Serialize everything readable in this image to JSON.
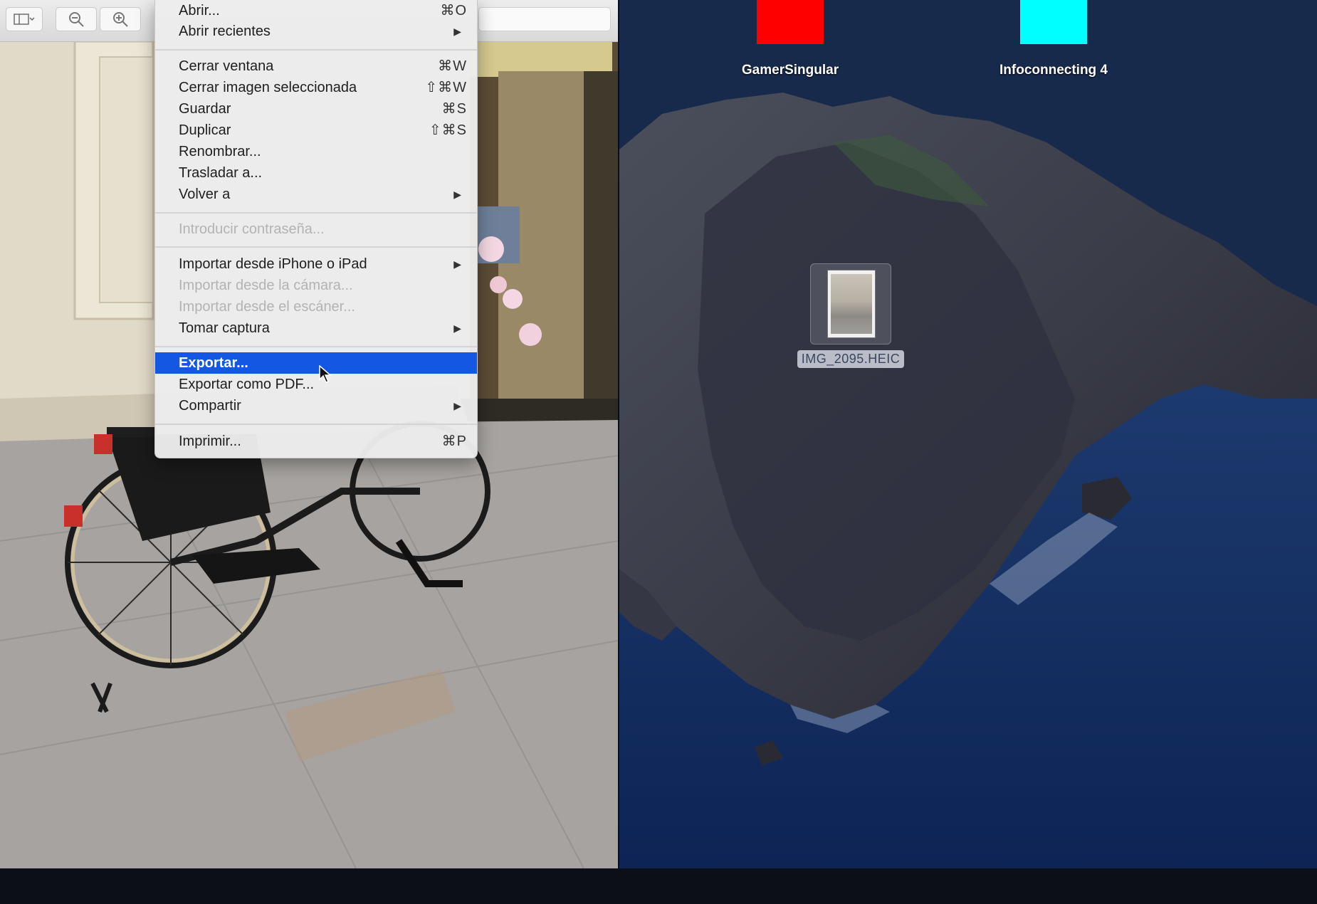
{
  "menu": {
    "items": [
      {
        "label": "Abrir...",
        "shortcut": "⌘O"
      },
      {
        "label": "Abrir recientes",
        "submenu": "▶"
      },
      {
        "label": "Cerrar ventana",
        "shortcut": "⌘W"
      },
      {
        "label": "Cerrar imagen seleccionada",
        "shortcut": "⇧⌘W"
      },
      {
        "label": "Guardar",
        "shortcut": "⌘S"
      },
      {
        "label": "Duplicar",
        "shortcut": "⇧⌘S"
      },
      {
        "label": "Renombrar..."
      },
      {
        "label": "Trasladar a..."
      },
      {
        "label": "Volver a",
        "submenu": "▶"
      },
      {
        "label": "Introducir contraseña...",
        "disabled": true
      },
      {
        "label": "Importar desde iPhone o iPad",
        "submenu": "▶"
      },
      {
        "label": "Importar desde la cámara...",
        "disabled": true
      },
      {
        "label": "Importar desde el escáner...",
        "disabled": true
      },
      {
        "label": "Tomar captura",
        "submenu": "▶"
      },
      {
        "label": "Exportar...",
        "highlighted": true
      },
      {
        "label": "Exportar como PDF..."
      },
      {
        "label": "Compartir",
        "submenu": "▶"
      },
      {
        "label": "Imprimir...",
        "shortcut": "⌘P"
      }
    ],
    "highlight_color": "#1457e2"
  },
  "desktop": {
    "icons": [
      {
        "label": "GamerSingular",
        "color": "#ff0000"
      },
      {
        "label": "Infoconnecting 4",
        "color": "#00ffff"
      }
    ],
    "file": {
      "name": "IMG_2095.HEIC"
    }
  },
  "toolbar": {
    "icons": [
      "sidebar-icon",
      "zoom-out-icon",
      "zoom-in-icon"
    ]
  }
}
